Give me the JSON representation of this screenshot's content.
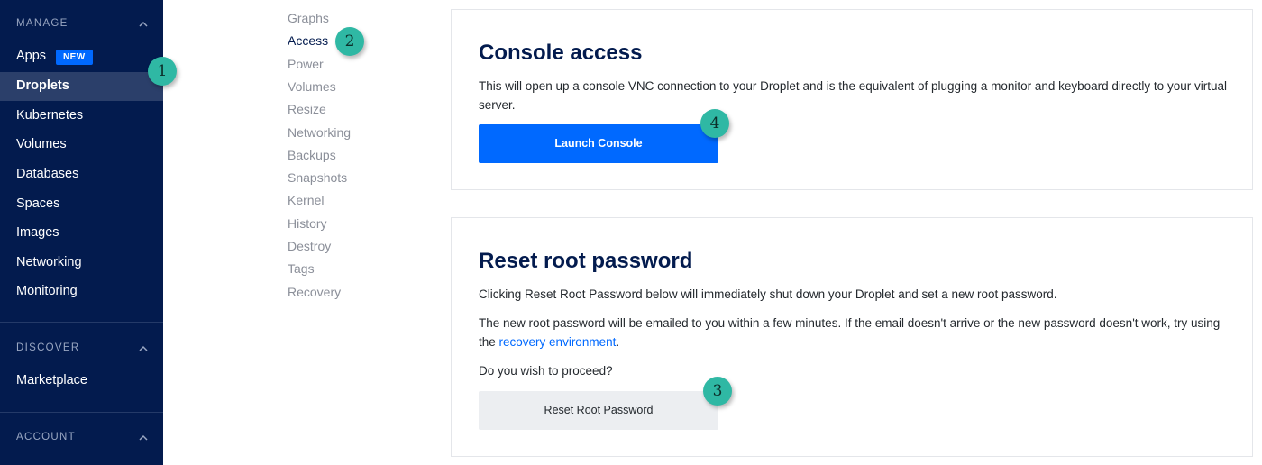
{
  "sidebar": {
    "manage": {
      "title": "MANAGE",
      "items": [
        {
          "label": "Apps",
          "badge": "NEW"
        },
        {
          "label": "Droplets"
        },
        {
          "label": "Kubernetes"
        },
        {
          "label": "Volumes"
        },
        {
          "label": "Databases"
        },
        {
          "label": "Spaces"
        },
        {
          "label": "Images"
        },
        {
          "label": "Networking"
        },
        {
          "label": "Monitoring"
        }
      ]
    },
    "discover": {
      "title": "DISCOVER",
      "items": [
        {
          "label": "Marketplace"
        }
      ]
    },
    "account": {
      "title": "ACCOUNT"
    },
    "active_item": "Droplets",
    "colors": {
      "background": "#031b4e",
      "active": "#2b3f6a",
      "badge": "#0069ff"
    }
  },
  "subnav": {
    "items": [
      "Graphs",
      "Access",
      "Power",
      "Volumes",
      "Resize",
      "Networking",
      "Backups",
      "Snapshots",
      "Kernel",
      "History",
      "Destroy",
      "Tags",
      "Recovery"
    ],
    "active": "Access"
  },
  "markers": [
    "1",
    "2",
    "3",
    "4"
  ],
  "console_access": {
    "title": "Console access",
    "description": "This will open up a console VNC connection to your Droplet and is the equivalent of plugging a monitor and keyboard directly to your virtual server.",
    "button_label": "Launch Console"
  },
  "reset_password": {
    "title": "Reset root password",
    "paragraph1": "Clicking Reset Root Password below will immediately shut down your Droplet and set a new root password.",
    "paragraph2_before": "The new root password will be emailed to you within a few minutes. If the email doesn't arrive or the new password doesn't work, try using the ",
    "paragraph2_link": "recovery environment",
    "paragraph2_after": ".",
    "question": "Do you wish to proceed?",
    "button_label": "Reset Root Password"
  },
  "icons": {
    "chevron": "chevron-up-icon"
  },
  "colors": {
    "primary": "#0069ff",
    "marker": "#2fb8a4",
    "heading": "#031b4e"
  }
}
